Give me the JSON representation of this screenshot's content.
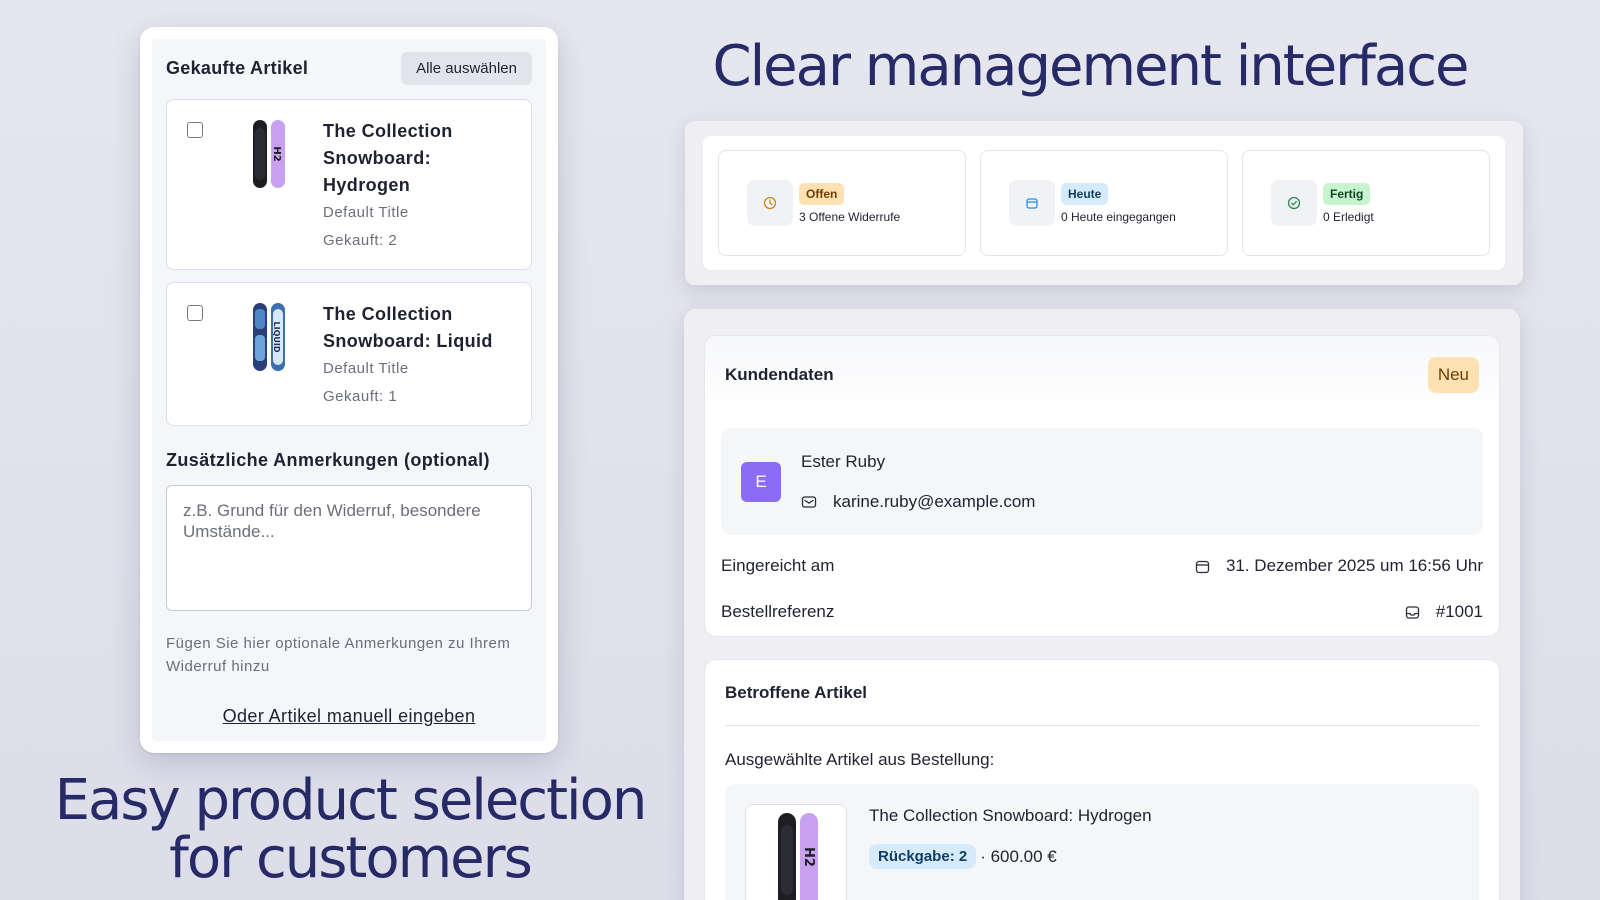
{
  "headlines": {
    "right": "Clear management interface",
    "left": "Easy product selection for customers"
  },
  "purchase_form": {
    "title": "Gekaufte Artikel",
    "select_all_label": "Alle auswählen",
    "items": [
      {
        "name": "The Collection Snowboard: Hydrogen",
        "variant": "Default Title",
        "purchased": "Gekauft: 2",
        "checked": false
      },
      {
        "name": "The Collection Snowboard: Liquid",
        "variant": "Default Title",
        "purchased": "Gekauft: 1",
        "checked": false
      }
    ],
    "notes_title": "Zusätzliche Anmerkungen (optional)",
    "notes_placeholder": "z.B. Grund für den Widerruf, besondere Umstände...",
    "notes_help": "Fügen Sie hier optionale Anmerkungen zu Ihrem Widerruf hinzu",
    "manual_link": "Oder Artikel manuell eingeben"
  },
  "stats": [
    {
      "badge": "Offen",
      "label": "3 Offene Widerrufe",
      "icon": "clock-icon",
      "color": "#c78a1a"
    },
    {
      "badge": "Heute",
      "label": "0 Heute eingegangen",
      "icon": "calendar-icon",
      "color": "#2a8fd6"
    },
    {
      "badge": "Fertig",
      "label": "0 Erledigt",
      "icon": "check-circle-icon",
      "color": "#2a8a4f"
    }
  ],
  "customer": {
    "section_title": "Kundendaten",
    "status_badge": "Neu",
    "avatar_initial": "E",
    "name": "Ester Ruby",
    "email": "karine.ruby@example.com",
    "submitted_label": "Eingereicht am",
    "submitted_value": "31. Dezember 2025 um 16:56 Uhr",
    "order_ref_label": "Bestellreferenz",
    "order_ref_value": "#1001"
  },
  "articles": {
    "section_title": "Betroffene Artikel",
    "subtitle": "Ausgewählte Artikel aus Bestellung:",
    "items": [
      {
        "name": "The Collection Snowboard: Hydrogen",
        "return_badge": "Rückgabe: 2",
        "price": "· 600.00 €"
      }
    ]
  },
  "colors": {
    "headline": "#262a66",
    "avatar": "#8b6cf5",
    "badge_new_bg": "#fde1b2"
  }
}
